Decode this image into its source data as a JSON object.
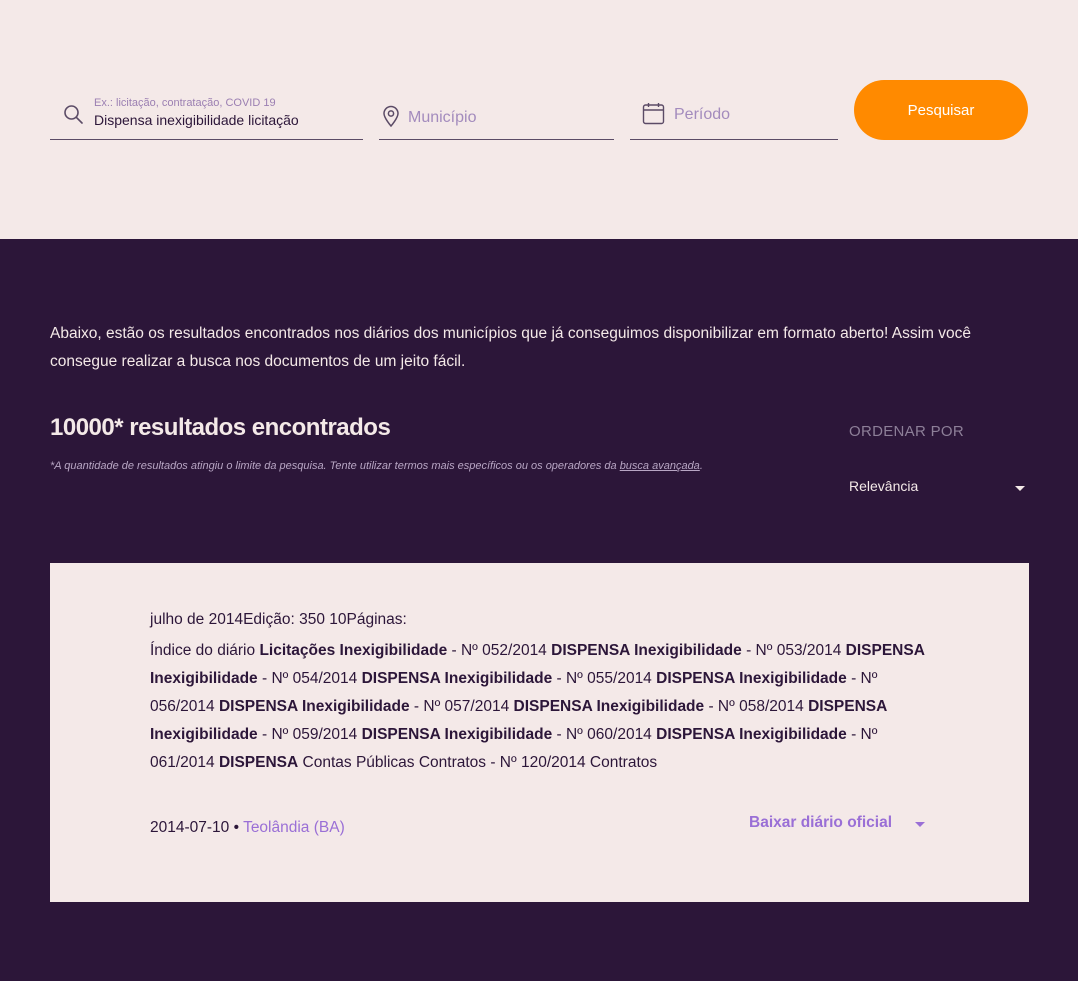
{
  "search": {
    "query_placeholder": "Ex.: licitação, contratação, COVID 19",
    "query_value": "Dispensa inexigibilidade licitação",
    "city_placeholder": "Município",
    "period_placeholder": "Período",
    "submit_label": "Pesquisar",
    "icons": {
      "query": "search-icon",
      "city": "map-pin-icon",
      "period": "calendar-icon"
    }
  },
  "results": {
    "intro": "Abaixo, estão os resultados encontrados nos diários dos municípios que já conseguimos disponibilizar em formato aberto! Assim você consegue realizar a busca nos documentos de um jeito fácil.",
    "count_text": "10000* resultados encontrados",
    "note_prefix": "*A quantidade de resultados atingiu o limite da pesquisa. Tente utilizar termos mais específicos ou os operadores da ",
    "note_link": "busca avançada",
    "note_suffix": ".",
    "sort_label": "ORDENAR POR",
    "sort_value": "Relevância"
  },
  "card": {
    "meta": "julho de 2014Edição: 350 10Páginas:",
    "excerpt": [
      {
        "t": "Índice do diário ",
        "b": false
      },
      {
        "t": "Licitações Inexigibilidade",
        "b": true
      },
      {
        "t": " - Nº 052/2014 ",
        "b": false
      },
      {
        "t": "DISPENSA Inexigibilidade",
        "b": true
      },
      {
        "t": " - Nº 053/2014 ",
        "b": false
      },
      {
        "t": "DISPENSA Inexigibilidade",
        "b": true
      },
      {
        "t": " - Nº 054/2014 ",
        "b": false
      },
      {
        "t": "DISPENSA Inexigibilidade",
        "b": true
      },
      {
        "t": " - Nº 055/2014 ",
        "b": false
      },
      {
        "t": "DISPENSA Inexigibilidade",
        "b": true
      },
      {
        "t": " - Nº 056/2014 ",
        "b": false
      },
      {
        "t": "DISPENSA Inexigibilidade",
        "b": true
      },
      {
        "t": " - Nº 057/2014 ",
        "b": false
      },
      {
        "t": "DISPENSA Inexigibilidade",
        "b": true
      },
      {
        "t": " - Nº 058/2014 ",
        "b": false
      },
      {
        "t": "DISPENSA Inexigibilidade",
        "b": true
      },
      {
        "t": " - Nº 059/2014 ",
        "b": false
      },
      {
        "t": "DISPENSA Inexigibilidade",
        "b": true
      },
      {
        "t": " - Nº 060/2014 ",
        "b": false
      },
      {
        "t": "DISPENSA Inexigibilidade",
        "b": true
      },
      {
        "t": " - Nº 061/2014 ",
        "b": false
      },
      {
        "t": "DISPENSA",
        "b": true
      },
      {
        "t": " Contas Públicas Contratos - Nº 120/2014 Contratos",
        "b": false
      }
    ],
    "date": "2014-07-10",
    "separator": " • ",
    "city": "Teolândia (BA)",
    "download_label": "Baixar diário oficial"
  },
  "colors": {
    "accent": "#ff8a00",
    "dark_bg": "#2c1639",
    "light_bg": "#f4e9e8",
    "link_purple": "#9a6fd6"
  }
}
